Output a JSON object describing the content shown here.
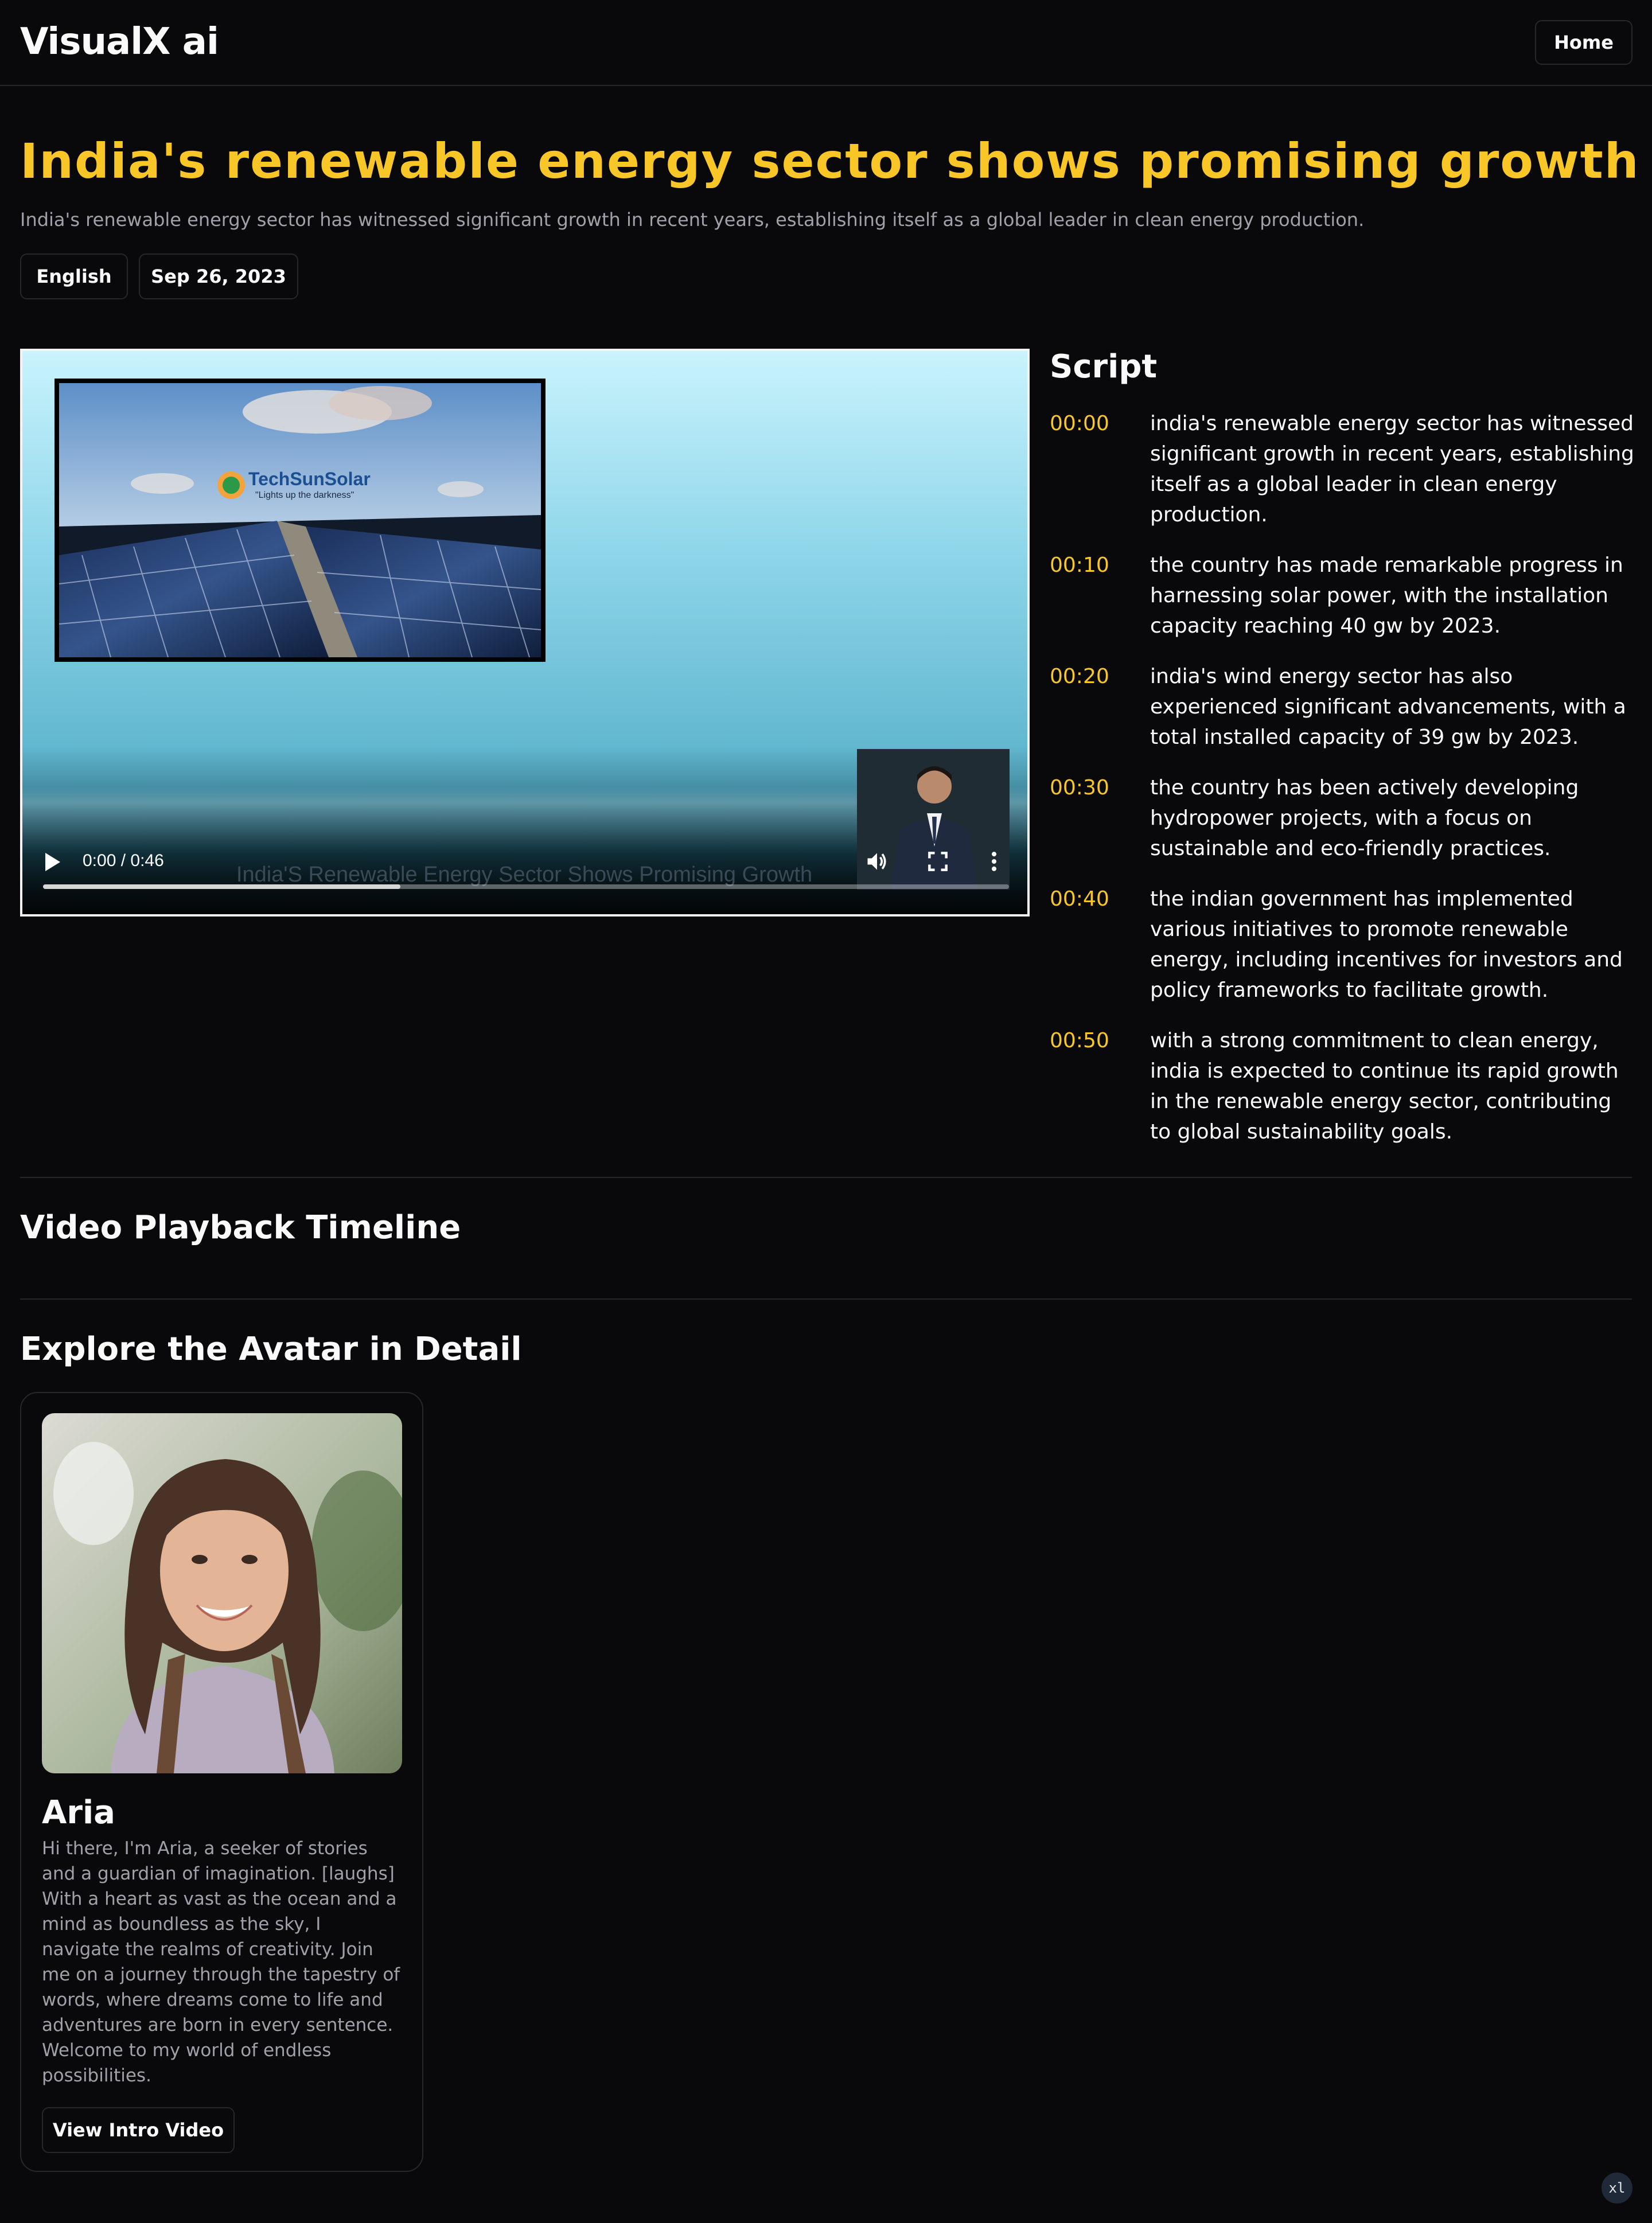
{
  "header": {
    "brand": "VisualX ai",
    "home_label": "Home"
  },
  "article": {
    "title": "India's renewable energy sector shows promising growth",
    "summary": "India's renewable energy sector has witnessed significant growth in recent years, establishing itself as a global leader in clean energy production.",
    "language": "English",
    "date": "Sep 26, 2023"
  },
  "video": {
    "time_display": "0:00 / 0:46",
    "caption": "India'S Renewable Energy Sector Shows Promising Growth",
    "logo_name": "TechSunSolar",
    "logo_tagline": "\"Lights up the darkness\"",
    "progress": 0.37,
    "icons": [
      "play-icon",
      "volume-icon",
      "fullscreen-icon",
      "more-options-icon"
    ]
  },
  "script": {
    "heading": "Script",
    "items": [
      {
        "time": "00:00",
        "text": "india's renewable energy sector has witnessed significant growth in recent years, establishing itself as a global leader in clean energy production."
      },
      {
        "time": "00:10",
        "text": "the country has made remarkable progress in harnessing solar power, with the installation capacity reaching 40 gw by 2023."
      },
      {
        "time": "00:20",
        "text": "india's wind energy sector has also experienced significant advancements, with a total installed capacity of 39 gw by 2023."
      },
      {
        "time": "00:30",
        "text": "the country has been actively developing hydropower projects, with a focus on sustainable and eco-friendly practices."
      },
      {
        "time": "00:40",
        "text": "the indian government has implemented various initiatives to promote renewable energy, including incentives for investors and policy frameworks to facilitate growth."
      },
      {
        "time": "00:50",
        "text": "with a strong commitment to clean energy, india is expected to continue its rapid growth in the renewable energy sector, contributing to global sustainability goals."
      }
    ]
  },
  "timeline": {
    "heading": "Video Playback Timeline"
  },
  "avatar_section": {
    "heading": "Explore the Avatar in Detail",
    "name": "Aria",
    "bio": "Hi there, I'm Aria, a seeker of stories and a guardian of imagination. [laughs] With a heart as vast as the ocean and a mind as boundless as the sky, I navigate the realms of creativity. Join me on a journey through the tapestry of words, where dreams come to life and adventures are born in every sentence. Welcome to my world of endless possibilities.",
    "button_label": "View Intro Video"
  },
  "badge": "xl",
  "colors": {
    "background": "#09090b",
    "accent": "#f8c627",
    "border": "#27272a",
    "muted_text": "#a1a1aa"
  }
}
